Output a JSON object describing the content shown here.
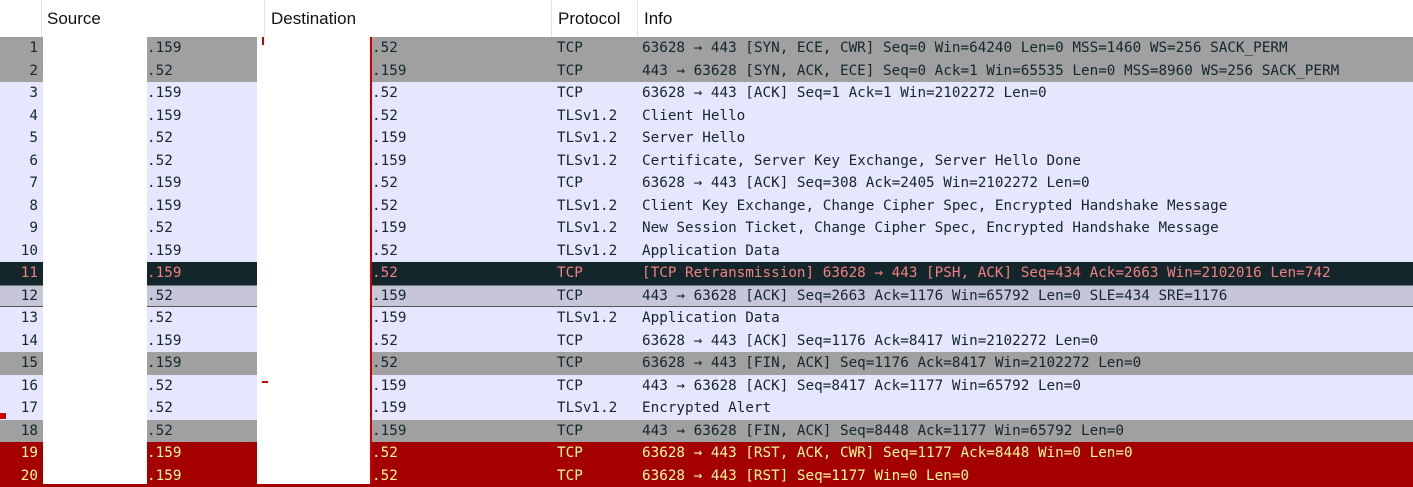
{
  "columns": {
    "source": "Source",
    "destination": "Destination",
    "protocol": "Protocol",
    "info": "Info"
  },
  "colors": {
    "gray_bg": "#a0a0a0",
    "lavender_bg": "#e7e6ff",
    "selected_bg": "#13262b",
    "selected_fg": "#f28080",
    "dup_ack_bg": "#c6c6d8",
    "rst_bg": "#a40000",
    "rst_fg": "#fffc9c",
    "default_fg": "#12272e"
  },
  "packets": [
    {
      "no": "1",
      "src": ".159",
      "dst": ".52",
      "proto": "TCP",
      "info": "63628 → 443 [SYN, ECE, CWR] Seq=0 Win=64240 Len=0 MSS=1460 WS=256 SACK_PERM",
      "style": "gray"
    },
    {
      "no": "2",
      "src": ".52",
      "dst": ".159",
      "proto": "TCP",
      "info": "443 → 63628 [SYN, ACK, ECE] Seq=0 Ack=1 Win=65535 Len=0 MSS=8960 WS=256 SACK_PERM",
      "style": "gray"
    },
    {
      "no": "3",
      "src": ".159",
      "dst": ".52",
      "proto": "TCP",
      "info": "63628 → 443 [ACK] Seq=1 Ack=1 Win=2102272 Len=0",
      "style": "lavender"
    },
    {
      "no": "4",
      "src": ".159",
      "dst": ".52",
      "proto": "TLSv1.2",
      "info": "Client Hello",
      "style": "lavender"
    },
    {
      "no": "5",
      "src": ".52",
      "dst": ".159",
      "proto": "TLSv1.2",
      "info": "Server Hello",
      "style": "lavender"
    },
    {
      "no": "6",
      "src": ".52",
      "dst": ".159",
      "proto": "TLSv1.2",
      "info": "Certificate, Server Key Exchange, Server Hello Done",
      "style": "lavender"
    },
    {
      "no": "7",
      "src": ".159",
      "dst": ".52",
      "proto": "TCP",
      "info": "63628 → 443 [ACK] Seq=308 Ack=2405 Win=2102272 Len=0",
      "style": "lavender"
    },
    {
      "no": "8",
      "src": ".159",
      "dst": ".52",
      "proto": "TLSv1.2",
      "info": "Client Key Exchange, Change Cipher Spec, Encrypted Handshake Message",
      "style": "lavender"
    },
    {
      "no": "9",
      "src": ".52",
      "dst": ".159",
      "proto": "TLSv1.2",
      "info": "New Session Ticket, Change Cipher Spec, Encrypted Handshake Message",
      "style": "lavender"
    },
    {
      "no": "10",
      "src": ".159",
      "dst": ".52",
      "proto": "TLSv1.2",
      "info": "Application Data",
      "style": "lavender"
    },
    {
      "no": "11",
      "src": ".159",
      "dst": ".52",
      "proto": "TCP",
      "info": "[TCP Retransmission] 63628 → 443 [PSH, ACK] Seq=434 Ack=2663 Win=2102016 Len=742",
      "style": "selected"
    },
    {
      "no": "12",
      "src": ".52",
      "dst": ".159",
      "proto": "TCP",
      "info": "443 → 63628 [ACK] Seq=2663 Ack=1176 Win=65792 Len=0 SLE=434 SRE=1176",
      "style": "dupack"
    },
    {
      "no": "13",
      "src": ".52",
      "dst": ".159",
      "proto": "TLSv1.2",
      "info": "Application Data",
      "style": "lavender"
    },
    {
      "no": "14",
      "src": ".159",
      "dst": ".52",
      "proto": "TCP",
      "info": "63628 → 443 [ACK] Seq=1176 Ack=8417 Win=2102272 Len=0",
      "style": "lavender"
    },
    {
      "no": "15",
      "src": ".159",
      "dst": ".52",
      "proto": "TCP",
      "info": "63628 → 443 [FIN, ACK] Seq=1176 Ack=8417 Win=2102272 Len=0",
      "style": "gray"
    },
    {
      "no": "16",
      "src": ".52",
      "dst": ".159",
      "proto": "TCP",
      "info": "443 → 63628 [ACK] Seq=8417 Ack=1177 Win=65792 Len=0",
      "style": "lavender"
    },
    {
      "no": "17",
      "src": ".52",
      "dst": ".159",
      "proto": "TLSv1.2",
      "info": "Encrypted Alert",
      "style": "lavender"
    },
    {
      "no": "18",
      "src": ".52",
      "dst": ".159",
      "proto": "TCP",
      "info": "443 → 63628 [FIN, ACK] Seq=8448 Ack=1177 Win=65792 Len=0",
      "style": "gray"
    },
    {
      "no": "19",
      "src": ".159",
      "dst": ".52",
      "proto": "TCP",
      "info": "63628 → 443 [RST, ACK, CWR] Seq=1177 Ack=8448 Win=0 Len=0",
      "style": "rst"
    },
    {
      "no": "20",
      "src": ".159",
      "dst": ".52",
      "proto": "TCP",
      "info": "63628 → 443 [RST] Seq=1177 Win=0 Len=0",
      "style": "rst"
    }
  ]
}
